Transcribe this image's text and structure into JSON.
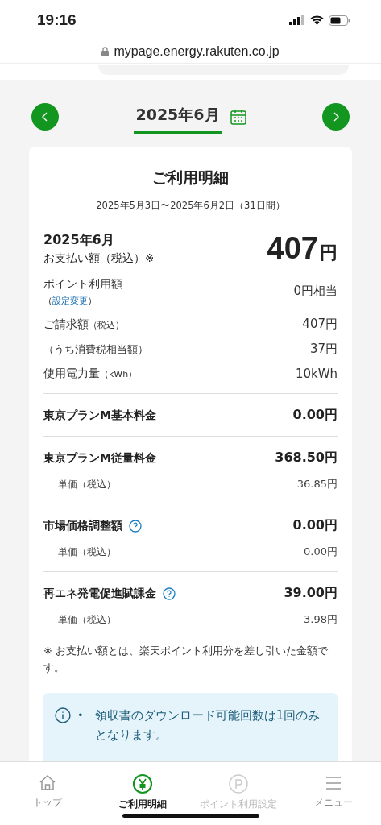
{
  "status_bar": {
    "time": "19:16"
  },
  "url_bar": {
    "url": "mypage.energy.rakuten.co.jp"
  },
  "month_nav": {
    "label": "2025年6月"
  },
  "statement": {
    "title": "ご利用明細",
    "period": "2025年5月3日〜2025年6月2日（31日間）",
    "month": "2025年6月",
    "total_label": "お支払い額（税込）※",
    "total_amount": "407",
    "total_unit": "円",
    "summary": [
      {
        "kind": "link",
        "label": "ポイント利用額",
        "link_before": "（",
        "link": "設定変更",
        "link_after": "）",
        "value": "0円相当"
      },
      {
        "kind": "main",
        "label": "ご請求額",
        "label_small": "（税込）",
        "value": "407円"
      },
      {
        "kind": "sub",
        "label": "（うち消費税相当額）",
        "value": "37円"
      },
      {
        "kind": "main",
        "label": "使用電力量",
        "label_small": "（kWh）",
        "value": "10kWh"
      }
    ],
    "charges": [
      {
        "label": "東京プランM基本料金",
        "help": false,
        "value": "0.00円"
      },
      {
        "label": "東京プランM従量料金",
        "help": false,
        "value": "368.50円",
        "unit_label": "単価（税込）",
        "unit_value": "36.85円"
      },
      {
        "label": "市場価格調整額",
        "help": true,
        "value": "0.00円",
        "unit_label": "単価（税込）",
        "unit_value": "0.00円"
      },
      {
        "label": "再エネ発電促進賦課金",
        "help": true,
        "value": "39.00円",
        "unit_label": "単価（税込）",
        "unit_value": "3.98円"
      }
    ],
    "footnote": "※ お支払い額とは、楽天ポイント利用分を差し引いた金額です。",
    "notice": [
      {
        "bullet": "•",
        "text": "領収書のダウンロード可能回数は1回のみとなります。"
      }
    ]
  },
  "bottom_nav": [
    {
      "kind": "home",
      "label": "トップ",
      "selected": false,
      "disabled": false
    },
    {
      "kind": "yen",
      "label": "ご利用明細",
      "selected": true,
      "disabled": false
    },
    {
      "kind": "point",
      "label": "ポイント利用設定",
      "selected": false,
      "disabled": true
    },
    {
      "kind": "menu",
      "label": "メニュー",
      "selected": false,
      "disabled": false
    }
  ]
}
